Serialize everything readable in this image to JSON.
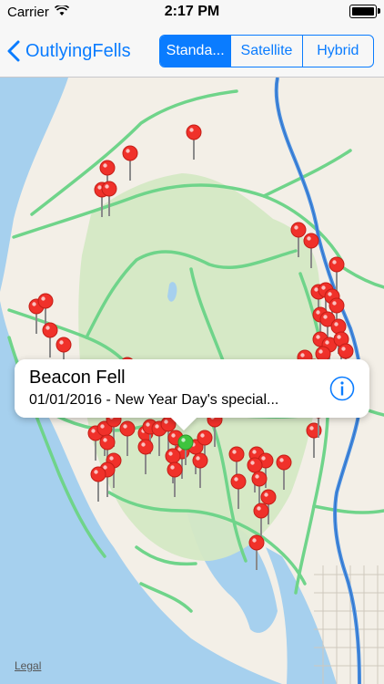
{
  "status": {
    "carrier": "Carrier",
    "time": "2:17 PM"
  },
  "nav": {
    "back_label": "OutlyingFells",
    "segments": [
      "Standa...",
      "Satellite",
      "Hybrid"
    ],
    "selected_segment": "Standa..."
  },
  "callout": {
    "title": "Beacon Fell",
    "subtitle": "01/01/2016 - New Year Day's special..."
  },
  "map": {
    "legal": "Legal",
    "colors": {
      "land": "#f3efe7",
      "sea": "#a6d0ee",
      "park": "#d4e8c4",
      "roads": "#6fd48a",
      "motorway": "#4a8fe0",
      "pin": "#f0312a",
      "selected_pin": "#3ec43e"
    }
  },
  "icons": {
    "back": "chevron-left-icon",
    "info": "info-icon",
    "wifi": "wifi-icon",
    "battery": "battery-icon"
  }
}
